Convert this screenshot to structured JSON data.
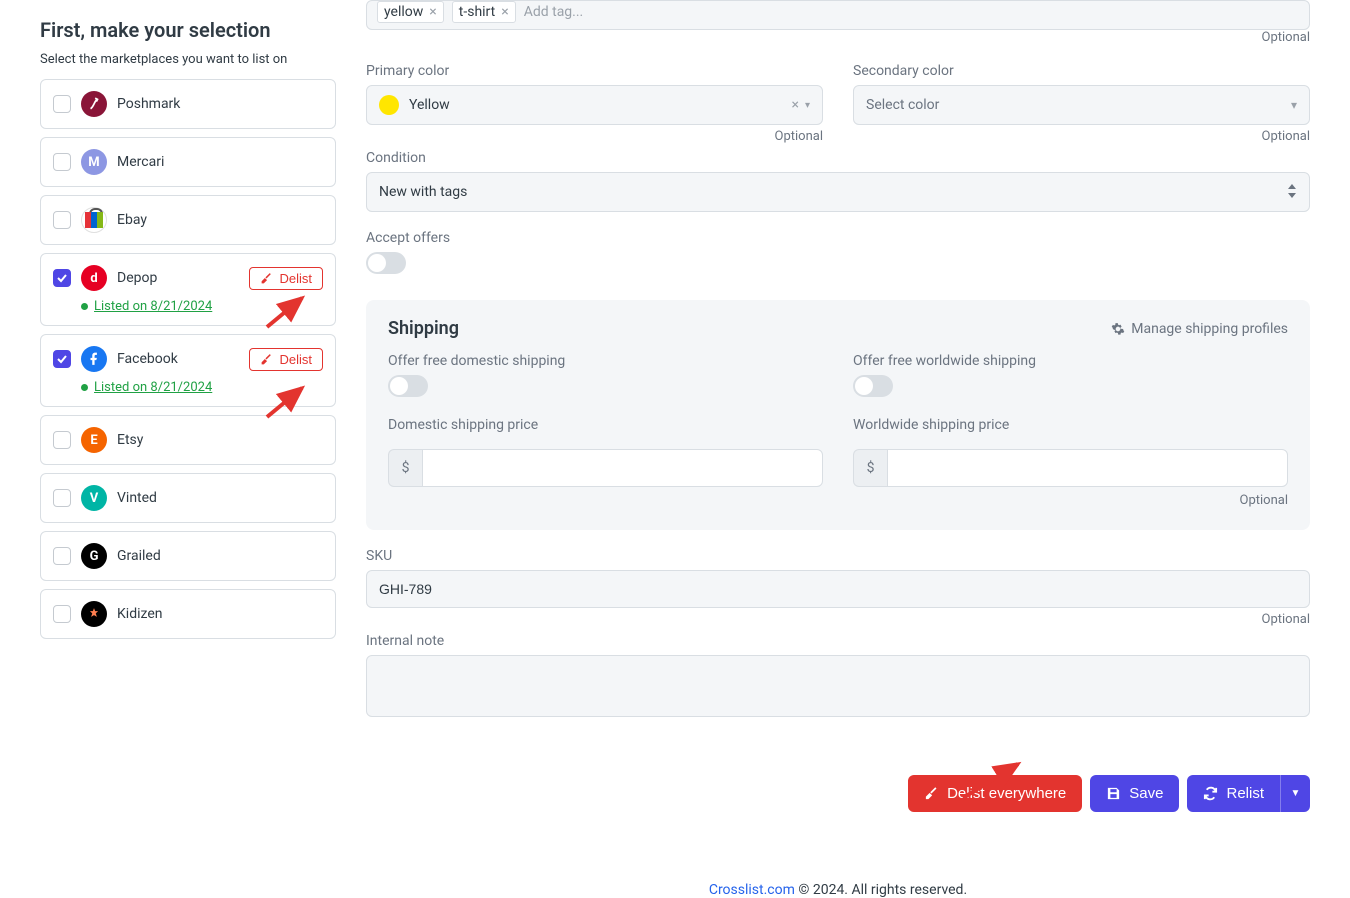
{
  "sidebar": {
    "heading": "First, make your selection",
    "subtitle": "Select the marketplaces you want to list on",
    "delist_label": "Delist",
    "items": [
      {
        "name": "Poshmark",
        "checked": false
      },
      {
        "name": "Mercari",
        "checked": false
      },
      {
        "name": "Ebay",
        "checked": false
      },
      {
        "name": "Depop",
        "checked": true,
        "listed": "Listed on 8/21/2024",
        "delist": true
      },
      {
        "name": "Facebook",
        "checked": true,
        "listed": "Listed on 8/21/2024",
        "delist": true
      },
      {
        "name": "Etsy",
        "checked": false
      },
      {
        "name": "Vinted",
        "checked": false
      },
      {
        "name": "Grailed",
        "checked": false
      },
      {
        "name": "Kidizen",
        "checked": false
      }
    ]
  },
  "tags": {
    "chips": [
      "yellow",
      "t-shirt"
    ],
    "placeholder": "Add tag..."
  },
  "optional_label": "Optional",
  "primary_color": {
    "label": "Primary color",
    "value": "Yellow"
  },
  "secondary_color": {
    "label": "Secondary color",
    "placeholder": "Select color"
  },
  "condition": {
    "label": "Condition",
    "value": "New with tags"
  },
  "accept_offers": {
    "label": "Accept offers",
    "value": false
  },
  "shipping": {
    "heading": "Shipping",
    "manage_link": "Manage shipping profiles",
    "free_domestic": {
      "label": "Offer free domestic shipping",
      "value": false
    },
    "free_worldwide": {
      "label": "Offer free worldwide shipping",
      "value": false
    },
    "domestic_price": {
      "label": "Domestic shipping price",
      "currency": "$",
      "value": ""
    },
    "worldwide_price": {
      "label": "Worldwide shipping price",
      "currency": "$",
      "value": ""
    }
  },
  "sku": {
    "label": "SKU",
    "value": "GHI-789"
  },
  "internal_note": {
    "label": "Internal note",
    "value": ""
  },
  "actions": {
    "delist_everywhere": "Delist everywhere",
    "save": "Save",
    "relist": "Relist"
  },
  "footer": {
    "link_text": "Crosslist.com",
    "rest": " © 2024. All rights reserved."
  }
}
